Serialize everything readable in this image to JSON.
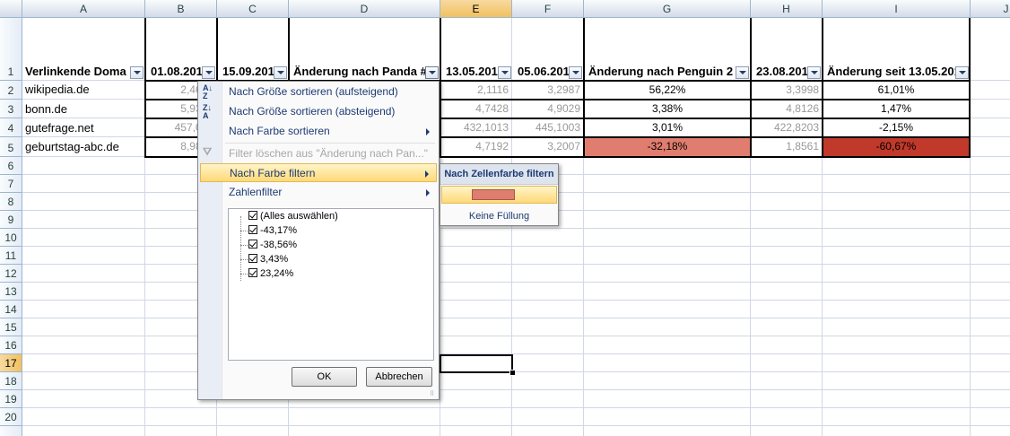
{
  "sheet": {
    "columns": [
      "A",
      "B",
      "C",
      "D",
      "E",
      "F",
      "G",
      "H",
      "I",
      "J"
    ],
    "rows": [
      "1",
      "2",
      "3",
      "4",
      "5",
      "6",
      "7",
      "8",
      "9",
      "10",
      "11",
      "12",
      "13",
      "14",
      "15",
      "16",
      "17",
      "18",
      "19",
      "20"
    ],
    "header_row": {
      "a": "Verlinkende Doma",
      "b": "01.08.201",
      "c": "15.09.201",
      "d": "Änderung nach Panda #",
      "e": "13.05.201",
      "f": "05.06.201",
      "g": "Änderung nach Penguin 2",
      "h": "23.08.201",
      "i": "Änderung seit 13.05.201"
    },
    "data_rows": [
      {
        "a": "wikipedia.de",
        "b": "2,4666",
        "e": "2,1116",
        "f": "3,2987",
        "g": "56,22%",
        "h": "3,3998",
        "i": "61,01%"
      },
      {
        "a": "bonn.de",
        "b": "5,9357",
        "e": "4,7428",
        "f": "4,9029",
        "g": "3,38%",
        "h": "4,8126",
        "i": "1,47%"
      },
      {
        "a": "gutefrage.net",
        "b": "457,077",
        "e": "432,1013",
        "f": "445,1003",
        "g": "3,01%",
        "h": "422,8203",
        "i": "-2,15%"
      },
      {
        "a": "geburtstag-abc.de",
        "b": "8,9866",
        "e": "4,7192",
        "f": "3,2007",
        "g": "-32,18%",
        "h": "1,8561",
        "i": "-60,67%"
      }
    ],
    "colors": {
      "light_red": "#e07d6e",
      "dark_red": "#c0392b",
      "selected_header": "#f1c15f"
    }
  },
  "filter_menu": {
    "sort_asc": "Nach Größe sortieren (aufsteigend)",
    "sort_desc": "Nach Größe sortieren (absteigend)",
    "sort_color": "Nach Farbe sortieren",
    "clear_filter": "Filter löschen aus \"Änderung nach Pan...\"",
    "filter_color": "Nach Farbe filtern",
    "number_filter": "Zahlenfilter",
    "list_items": [
      "(Alles auswählen)",
      "-43,17%",
      "-38,56%",
      "3,43%",
      "23,24%"
    ],
    "ok": "OK",
    "cancel": "Abbrechen",
    "icons": {
      "sort_asc": "sort-az-icon",
      "sort_desc": "sort-za-icon",
      "clear": "funnel-clear-icon"
    }
  },
  "color_submenu": {
    "title": "Nach Zellenfarbe filtern",
    "swatch_color": "#e07d6e",
    "no_fill": "Keine Füllung"
  }
}
